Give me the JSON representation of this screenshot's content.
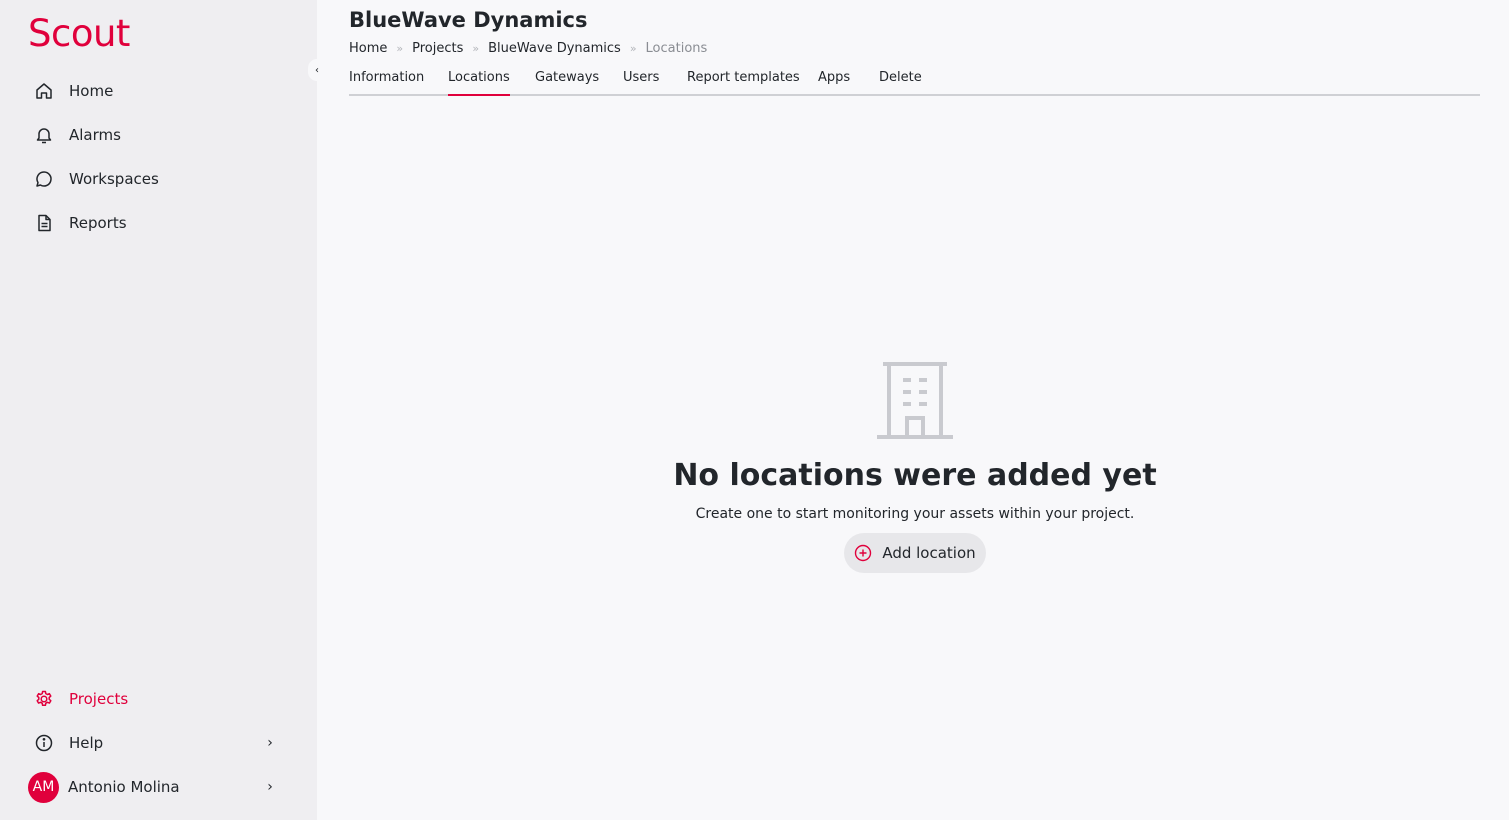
{
  "app": {
    "logo": "Scout",
    "brand_color": "#e0003c"
  },
  "sidebar": {
    "items": [
      {
        "label": "Home",
        "icon": "home-icon"
      },
      {
        "label": "Alarms",
        "icon": "bell-icon"
      },
      {
        "label": "Workspaces",
        "icon": "chat-bubble-icon"
      },
      {
        "label": "Reports",
        "icon": "document-icon"
      }
    ],
    "bottom": {
      "projects": {
        "label": "Projects",
        "icon": "gear-icon",
        "active": true
      },
      "help": {
        "label": "Help",
        "icon": "info-icon",
        "chevron": "›"
      },
      "user": {
        "initials": "AM",
        "name": "Antonio Molina",
        "chevron": "›"
      }
    },
    "collapse_glyph": "‹"
  },
  "header": {
    "title": "BlueWave Dynamics",
    "breadcrumb": [
      "Home",
      "Projects",
      "BlueWave Dynamics",
      "Locations"
    ],
    "breadcrumb_sep": "»"
  },
  "tabs": [
    {
      "label": "Information"
    },
    {
      "label": "Locations",
      "active": true
    },
    {
      "label": "Gateways"
    },
    {
      "label": "Users"
    },
    {
      "label": "Report templates"
    },
    {
      "label": "Apps"
    },
    {
      "label": "Delete"
    }
  ],
  "empty_state": {
    "icon": "building-icon",
    "title": "No locations were added yet",
    "subtitle": "Create one to start monitoring your assets within your project.",
    "button_label": "Add location",
    "button_icon": "plus-circle-icon"
  }
}
